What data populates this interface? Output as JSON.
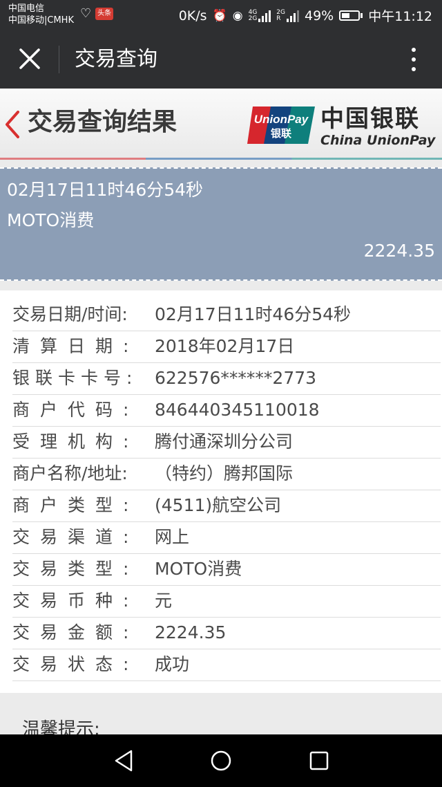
{
  "status_bar": {
    "carrier1": "中国电信",
    "carrier2": "中国移动|CMHK",
    "toutiao_badge": "头条",
    "net_speed": "0K/s",
    "net_4g": "4G",
    "net_4g_2": "2G",
    "net_2g": "2G",
    "net_2g_2": "R",
    "battery": "49%",
    "battery_level": 49,
    "time": "中午11:12"
  },
  "header": {
    "title": "交易查询"
  },
  "banner": {
    "title": "交易查询结果",
    "brand_cn": "中国银联",
    "brand_en": "China UnionPay",
    "logo_text_en": "UnionPay",
    "logo_text_cn": "银联"
  },
  "summary": {
    "datetime": "02月17日11时46分54秒",
    "type": "MOTO消费",
    "amount": "2224.35"
  },
  "details": [
    {
      "label": "交易日期/时间:",
      "value": "02月17日11时46分54秒"
    },
    {
      "label": "清算日期:",
      "value": "2018年02月17日"
    },
    {
      "label": "银联卡卡号:",
      "value": "622576******2773"
    },
    {
      "label": "商户代码:",
      "value": "846440345110018"
    },
    {
      "label": "受理机构:",
      "value": "腾付通深圳分公司"
    },
    {
      "label": "商户名称/地址:",
      "value": "（特约）腾邦国际"
    },
    {
      "label": "商户类型:",
      "value": "(4511)航空公司"
    },
    {
      "label": "交易渠道:",
      "value": "网上"
    },
    {
      "label": "交易类型:",
      "value": "MOTO消费"
    },
    {
      "label": "交易币种:",
      "value": "元"
    },
    {
      "label": "交易金额:",
      "value": "2224.35"
    },
    {
      "label": "交易状态:",
      "value": "成功"
    }
  ],
  "tip": "温馨提示:"
}
